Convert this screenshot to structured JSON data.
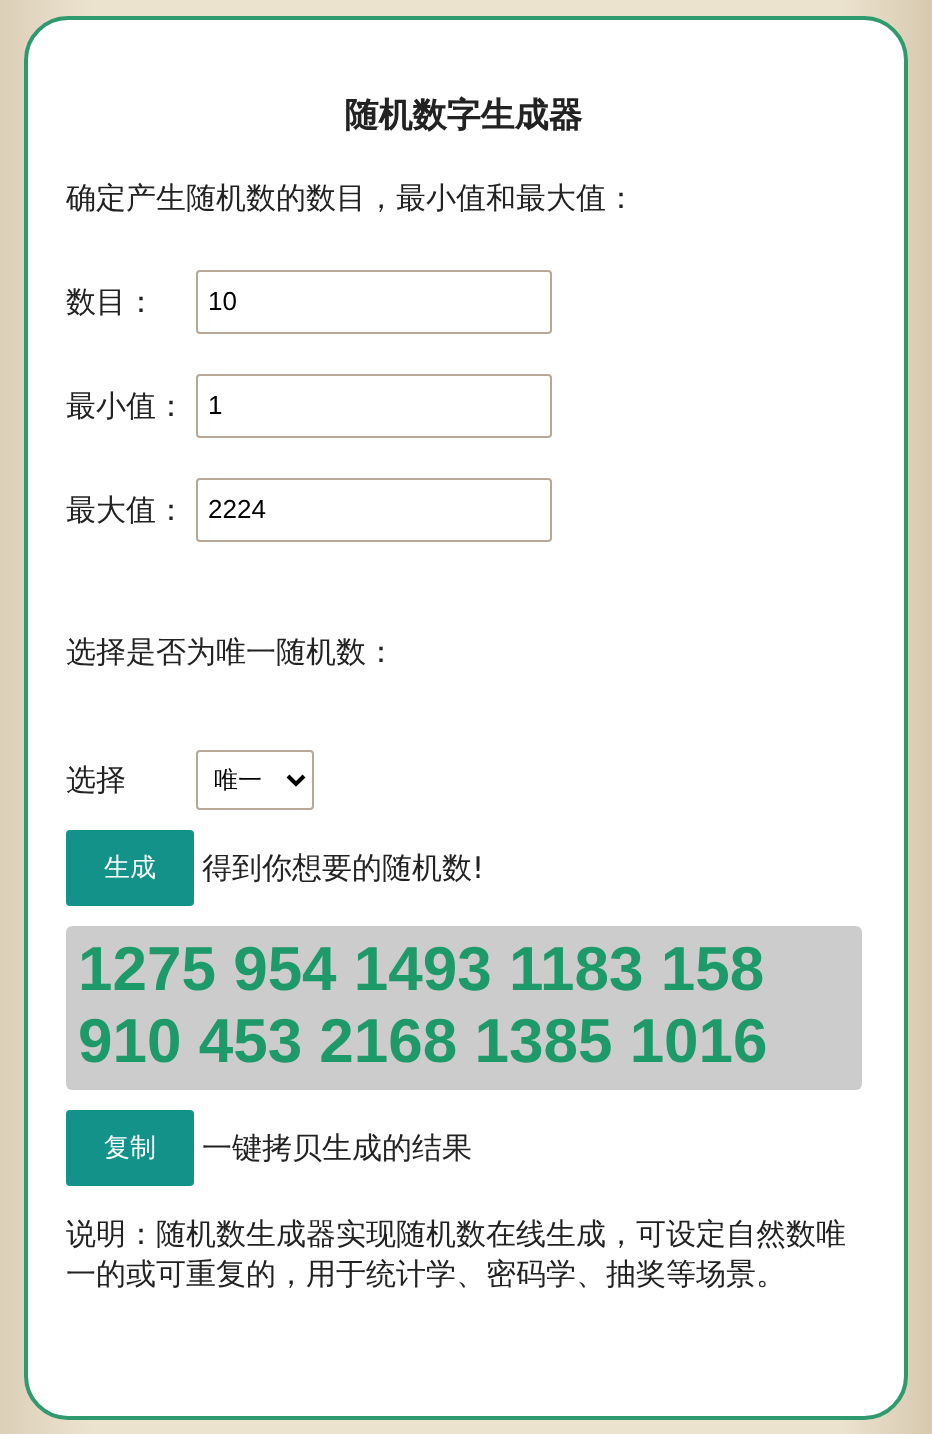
{
  "title": "随机数字生成器",
  "intro": "确定产生随机数的数目，最小值和最大值：",
  "fields": [
    {
      "label": "数目：",
      "value": "10"
    },
    {
      "label": "最小值：",
      "value": "1"
    },
    {
      "label": "最大值：",
      "value": "2224"
    }
  ],
  "unique_prompt": "选择是否为唯一随机数：",
  "select": {
    "label": "选择",
    "value": "唯一"
  },
  "generate": {
    "button": "生成",
    "hint": "得到你想要的随机数!"
  },
  "result": "1275 954 1493 1183 158 910 453 2168 1385 1016",
  "copy": {
    "button": "复制",
    "hint": "一键拷贝生成的结果"
  },
  "description": "说明：随机数生成器实现随机数在线生成，可设定自然数唯一的或可重复的，用于统计学、密码学、抽奖等场景。"
}
